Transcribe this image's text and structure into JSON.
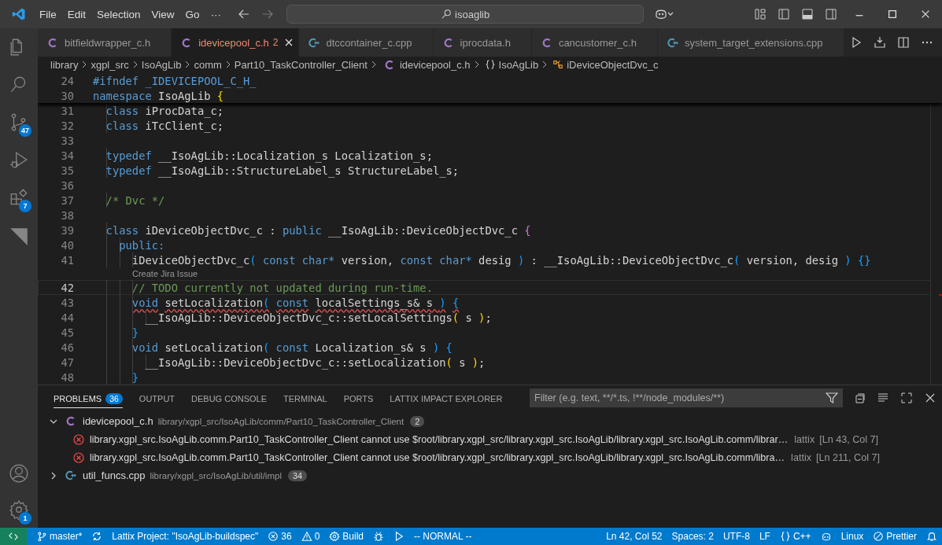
{
  "title_bar": {
    "menu": [
      "File",
      "Edit",
      "Selection",
      "View",
      "Go",
      "···"
    ],
    "search": "isoaglib"
  },
  "activity_bar": {
    "top": [
      {
        "kind": "files",
        "selected": false
      },
      {
        "kind": "search",
        "selected": false
      },
      {
        "kind": "source-control",
        "badge": "47",
        "selected": false
      },
      {
        "kind": "run-debug",
        "selected": false
      },
      {
        "kind": "extensions",
        "badge": "7",
        "selected": false
      },
      {
        "kind": "triangle",
        "selected": false
      }
    ],
    "bottom": [
      {
        "kind": "account"
      },
      {
        "kind": "settings",
        "badge": "1"
      }
    ]
  },
  "tabs": [
    {
      "label": "bitfieldwrapper_c.h",
      "kind": "c",
      "selected": false
    },
    {
      "label": "idevicepool_c.h",
      "kind": "c",
      "selected": true,
      "problems": "2"
    },
    {
      "label": "dtccontainer_c.cpp",
      "kind": "cpp",
      "selected": false
    },
    {
      "label": "iprocdata.h",
      "kind": "c",
      "selected": false
    },
    {
      "label": "cancustomer_c.h",
      "kind": "c",
      "selected": false
    },
    {
      "label": "system_target_extensions.cpp",
      "kind": "cpp",
      "selected": false
    }
  ],
  "breadcrumbs": [
    {
      "label": "library"
    },
    {
      "label": "xgpl_src"
    },
    {
      "label": "IsoAgLib"
    },
    {
      "label": "comm"
    },
    {
      "label": "Part10_TaskController_Client"
    },
    {
      "label": "idevicepool_c.h",
      "kind": "c"
    },
    {
      "label": "IsoAgLib",
      "kind": "namespace"
    },
    {
      "label": "iDeviceObjectDvc_c",
      "kind": "class"
    }
  ],
  "editor": {
    "sticky": [
      {
        "number": "24",
        "tokens": [
          {
            "kind": "keyword",
            "t": "#ifndef _IDEVICEPOOL_C_H_"
          }
        ]
      },
      {
        "number": "30",
        "tokens": [
          {
            "kind": "keyword",
            "t": "namespace"
          },
          {
            "kind": "plain",
            "t": " IsoAgLib "
          },
          {
            "kind": "bracket1",
            "t": "{"
          }
        ]
      }
    ],
    "lines": [
      {
        "number": "31",
        "tokens": [
          {
            "kind": "keyword",
            "t": "  class"
          },
          {
            "kind": "plain",
            "t": " iProcData_c;"
          }
        ]
      },
      {
        "number": "32",
        "tokens": [
          {
            "kind": "keyword",
            "t": "  class"
          },
          {
            "kind": "plain",
            "t": " iTcClient_c;"
          }
        ]
      },
      {
        "number": "33"
      },
      {
        "number": "34",
        "tokens": [
          {
            "kind": "keyword",
            "t": "  typedef"
          },
          {
            "kind": "plain",
            "t": " __IsoAgLib::Localization_s Localization_s;"
          }
        ]
      },
      {
        "number": "35",
        "tokens": [
          {
            "kind": "keyword",
            "t": "  typedef"
          },
          {
            "kind": "plain",
            "t": " __IsoAgLib::StructureLabel_s StructureLabel_s;"
          }
        ]
      },
      {
        "number": "36"
      },
      {
        "number": "37",
        "tokens": [
          {
            "kind": "comment",
            "t": "  /* Dvc */"
          }
        ]
      },
      {
        "number": "38"
      },
      {
        "number": "39",
        "tokens": [
          {
            "kind": "keyword",
            "t": "  class"
          },
          {
            "kind": "plain",
            "t": " iDeviceObjectDvc_c : "
          },
          {
            "kind": "keyword",
            "t": "public"
          },
          {
            "kind": "plain",
            "t": " __IsoAgLib::DeviceObjectDvc_c "
          },
          {
            "kind": "bracket2",
            "t": "{"
          }
        ]
      },
      {
        "number": "40",
        "tokens": [
          {
            "kind": "keyword",
            "t": "    public:"
          }
        ]
      },
      {
        "number": "41",
        "tokens": [
          {
            "kind": "plain",
            "t": "      iDeviceObjectDvc_c"
          },
          {
            "kind": "bracket3",
            "t": "("
          },
          {
            "kind": "keyword",
            "t": " const char*"
          },
          {
            "kind": "plain",
            "t": " version, "
          },
          {
            "kind": "keyword",
            "t": "const char*"
          },
          {
            "kind": "plain",
            "t": " desig "
          },
          {
            "kind": "bracket3",
            "t": ")"
          },
          {
            "kind": "plain",
            "t": " : __IsoAgLib::DeviceObjectDvc_c"
          },
          {
            "kind": "bracket3",
            "t": "("
          },
          {
            "kind": "plain",
            "t": " version, desig "
          },
          {
            "kind": "bracket3",
            "t": ")"
          },
          {
            "kind": "bracket3",
            "t": " {}"
          }
        ],
        "codelens": "Create Jira Issue"
      },
      {
        "number": "42",
        "current": true,
        "tokens": [
          {
            "kind": "comment",
            "t": "      // TODO currently not updated during run-time."
          }
        ]
      },
      {
        "number": "43",
        "squiggle": true,
        "tokens": [
          {
            "kind": "keyword",
            "t": "      void"
          },
          {
            "kind": "plain",
            "t": " setLocalization"
          },
          {
            "kind": "bracket3",
            "t": "("
          },
          {
            "kind": "keyword",
            "t": " const"
          },
          {
            "kind": "plain",
            "t": " localSettings_s& s "
          },
          {
            "kind": "bracket3",
            "t": ")"
          },
          {
            "kind": "bracket3",
            "t": " {"
          }
        ]
      },
      {
        "number": "44",
        "tokens": [
          {
            "kind": "plain",
            "t": "        __IsoAgLib::DeviceObjectDvc_c::setLocalSettings"
          },
          {
            "kind": "bracket1",
            "t": "("
          },
          {
            "kind": "plain",
            "t": " s "
          },
          {
            "kind": "bracket1",
            "t": ")"
          },
          {
            "kind": "plain",
            "t": ";"
          }
        ]
      },
      {
        "number": "45",
        "tokens": [
          {
            "kind": "bracket3",
            "t": "      }"
          }
        ]
      },
      {
        "number": "46",
        "tokens": [
          {
            "kind": "keyword",
            "t": "      void"
          },
          {
            "kind": "plain",
            "t": " setLocalization"
          },
          {
            "kind": "bracket3",
            "t": "("
          },
          {
            "kind": "keyword",
            "t": " const"
          },
          {
            "kind": "plain",
            "t": " Localization_s& s "
          },
          {
            "kind": "bracket3",
            "t": ")"
          },
          {
            "kind": "bracket3",
            "t": " {"
          }
        ]
      },
      {
        "number": "47",
        "tokens": [
          {
            "kind": "plain",
            "t": "        __IsoAgLib::DeviceObjectDvc_c::setLocalization"
          },
          {
            "kind": "bracket1",
            "t": "("
          },
          {
            "kind": "plain",
            "t": " s "
          },
          {
            "kind": "bracket1",
            "t": ")"
          },
          {
            "kind": "plain",
            "t": ";"
          }
        ]
      },
      {
        "number": "48",
        "tokens": [
          {
            "kind": "bracket3",
            "t": "      }"
          }
        ]
      }
    ]
  },
  "panel": {
    "tabs": [
      {
        "label": "PROBLEMS",
        "badge": "36",
        "selected": true
      },
      {
        "label": "OUTPUT",
        "selected": false
      },
      {
        "label": "DEBUG CONSOLE",
        "selected": false
      },
      {
        "label": "TERMINAL",
        "selected": false
      },
      {
        "label": "PORTS",
        "selected": false
      },
      {
        "label": "LATTIX IMPACT EXPLORER",
        "selected": false
      }
    ],
    "filter": {
      "placeholder": "Filter (e.g. text, **/*.ts, !**/node_modules/**)"
    },
    "files": [
      {
        "name": "idevicepool_c.h",
        "kind": "c",
        "path": "library/xgpl_src/IsoAgLib/comm/Part10_TaskController_Client",
        "count": "2",
        "expanded": true,
        "problems": [
          {
            "message": "library.xgpl_src.IsoAgLib.comm.Part10_TaskController_Client cannot use $root/library.xgpl_src/library.xgpl_src.IsoAgLib/library.xgpl_src.IsoAgLib.comm/librar…",
            "source": "lattix",
            "location": "[Ln 43, Col 7]"
          },
          {
            "message": "library.xgpl_src.IsoAgLib.comm.Part10_TaskController_Client cannot use $root/library.xgpl_src/library.xgpl_src.IsoAgLib/library.xgpl_src.IsoAgLib.comm/libra…",
            "source": "lattix",
            "location": "[Ln 211, Col 7]"
          }
        ]
      },
      {
        "name": "util_funcs.cpp",
        "kind": "cpp",
        "path": "library/xgpl_src/IsoAgLib/util/impl",
        "count": "34",
        "expanded": false
      }
    ]
  },
  "status_bar": {
    "left": [
      {
        "kind": "branch",
        "text": "master*"
      },
      {
        "kind": "sync"
      },
      {
        "kind": "text",
        "text": "Lattix Project: \"IsoAgLib-buildspec\""
      },
      {
        "kind": "errors",
        "text": "36"
      },
      {
        "kind": "warnings",
        "text": "0"
      },
      {
        "kind": "build",
        "text": "Build"
      },
      {
        "kind": "debug"
      },
      {
        "kind": "run"
      },
      {
        "kind": "text",
        "text": "-- NORMAL --"
      }
    ],
    "right": [
      {
        "kind": "text",
        "text": "Ln 42, Col 52"
      },
      {
        "kind": "text",
        "text": "Spaces: 2"
      },
      {
        "kind": "text",
        "text": "UTF-8"
      },
      {
        "kind": "text",
        "text": "LF"
      },
      {
        "kind": "language",
        "text": "C++"
      },
      {
        "kind": "assistant"
      },
      {
        "kind": "text",
        "text": "Linux"
      },
      {
        "kind": "formatter",
        "text": "Prettier"
      },
      {
        "kind": "notifications"
      }
    ]
  }
}
